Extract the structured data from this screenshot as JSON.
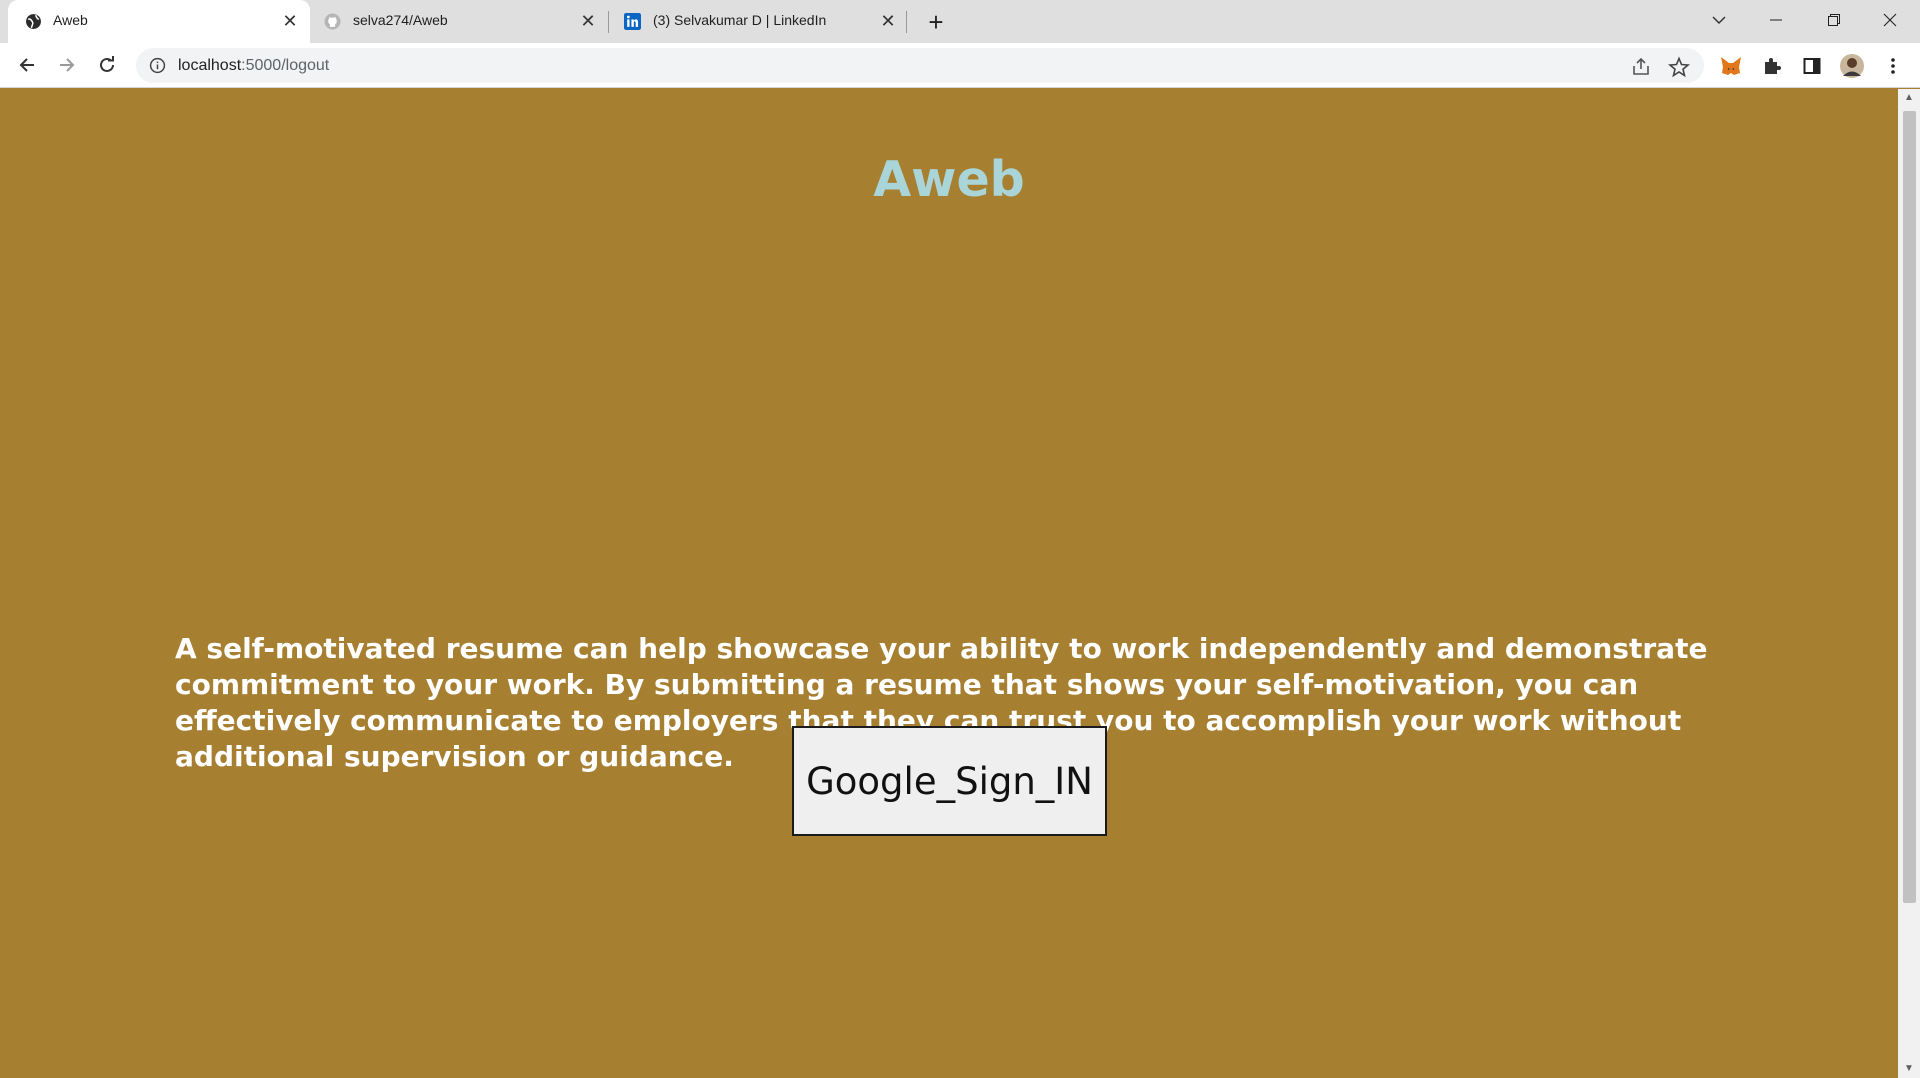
{
  "browser": {
    "tabs": [
      {
        "title": "Aweb",
        "favicon": "globe-icon",
        "active": true
      },
      {
        "title": "selva274/Aweb",
        "favicon": "github-icon",
        "active": false
      },
      {
        "title": "(3) Selvakumar D | LinkedIn",
        "favicon": "linkedin-icon",
        "active": false
      }
    ],
    "url_host": "localhost",
    "url_path": ":5000/logout",
    "accent_color": "#1a73e8"
  },
  "page": {
    "title": "Aweb",
    "blurb": "A self-motivated resume can help showcase your ability to work independently and demonstrate commitment to your work. By submitting a resume that shows your self-motivation, you can effectively communicate to employers that they can trust you to accomplish your work without additional supervision or guidance.",
    "signin_label": "Google_Sign_IN",
    "background_color": "#a77f31",
    "title_color": "#a9d4d8"
  }
}
